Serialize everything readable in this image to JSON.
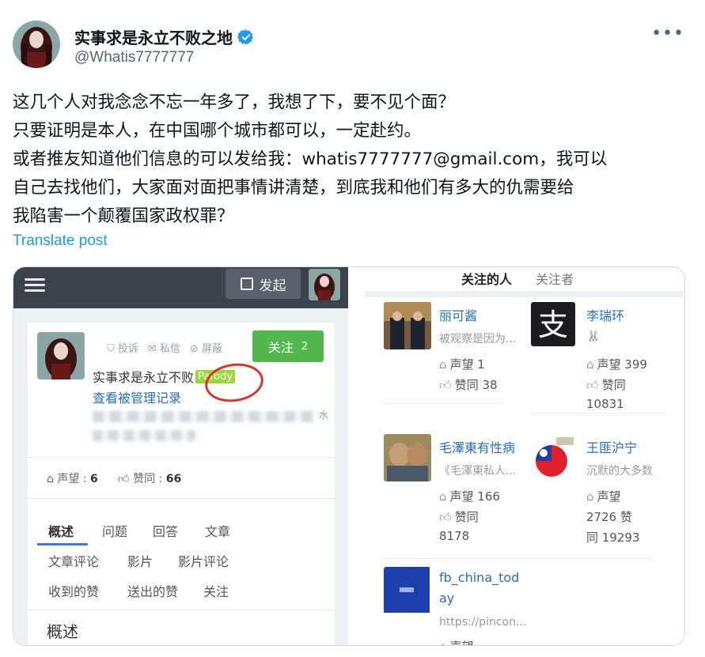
{
  "header": {
    "display_name": "实事求是永立不败之地",
    "handle": "@Whatis7777777",
    "more_label": "•••",
    "verified_color": "#1d9bf0"
  },
  "post": {
    "lines": [
      "这几个人对我念念不忘一年多了，我想了下，要不见个面？",
      "只要证明是本人，在中国哪个城市都可以，一定赴约。",
      "或者推友知道他们信息的可以发给我：whatis7777777@gmail.com，我可以",
      "自己去找他们，大家面对面把事情讲清楚，到底我和他们有多大的仇需要给",
      "我陷害一个颠覆国家政权罪？"
    ],
    "translate_label": "Translate post"
  },
  "left_shot": {
    "post_button": "发起",
    "actions": [
      "投诉",
      "私信",
      "屏蔽"
    ],
    "follow_label": "关注",
    "follow_count": "2",
    "profile_name": "实事求是永立不败",
    "badge": "Parody",
    "mod_link": "查看被管理记录",
    "blur_char": "水",
    "reputation_label": "声望 : ",
    "reputation_value": "6",
    "likes_label": "赞同 : ",
    "likes_value": "66",
    "tabs": [
      "概述",
      "问题",
      "回答",
      "文章",
      "文章评论",
      "影片",
      "影片评论",
      "收到的赞",
      "送出的赞",
      "关注"
    ],
    "overview_title": "概述"
  },
  "right_shot": {
    "tabs": [
      "关注的人",
      "关注者"
    ],
    "users": [
      {
        "name": "丽可酱",
        "desc": "被观察是因为...",
        "line1": "声望 1",
        "line2": "赞同 38",
        "line3": ""
      },
      {
        "name": "李瑞环",
        "desc": "🐰",
        "line1": "声望 399",
        "line2": "赞同",
        "line3": "10831"
      },
      {
        "name": "毛澤東有性病",
        "desc": "《毛澤東私人...",
        "line1": "声望 166",
        "line2": "赞同",
        "line3": "8178"
      },
      {
        "name": "王匪沪宁",
        "desc": "沉默的大多数",
        "line1": "声望",
        "line2": "2726  赞",
        "line3": "同 19293"
      },
      {
        "name": "fb_china_tod",
        "name2": "ay",
        "desc": "https://pincon...",
        "line1": "声望",
        "line2": "",
        "line3": ""
      }
    ]
  }
}
